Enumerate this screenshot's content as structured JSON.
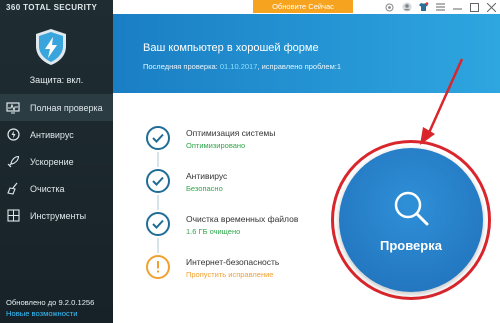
{
  "app": {
    "brand": "360 TOTAL SECURITY"
  },
  "sidebar": {
    "protection_text": "Защита: вкл.",
    "items": [
      {
        "label": "Полная проверка",
        "icon": "monitor-icon"
      },
      {
        "label": "Антивирус",
        "icon": "bolt-icon"
      },
      {
        "label": "Ускорение",
        "icon": "rocket-icon"
      },
      {
        "label": "Очистка",
        "icon": "broom-icon"
      },
      {
        "label": "Инструменты",
        "icon": "grid-icon"
      }
    ],
    "footer": {
      "version": "Обновлено до 9.2.0.1256",
      "link": "Новые возможности"
    }
  },
  "topbar": {
    "update_button": "Обновите Сейчас"
  },
  "banner": {
    "title": "Ваш компьютер в хорошей форме",
    "last_check_prefix": "Последняя проверка:",
    "last_check_date": "01.10.2017",
    "last_check_suffix": ", исправлено проблем:1"
  },
  "status": [
    {
      "title": "Оптимизация системы",
      "state": "Оптимизировано",
      "type": "ok"
    },
    {
      "title": "Антивирус",
      "state": "Безопасно",
      "type": "ok"
    },
    {
      "title": "Очистка временных файлов",
      "state": "1.6 ГБ очищено",
      "type": "ok"
    },
    {
      "title": "Интернет-безопасность",
      "state": "Пропустить исправление",
      "type": "warn"
    }
  ],
  "scan_button": {
    "label": "Проверка"
  },
  "colors": {
    "sidebar_bg": "#1f2d33",
    "banner": "#1a7ec4",
    "ok": "#2fa64a",
    "warn": "#f0a030",
    "update": "#f6a420",
    "halo": "#d9262c"
  }
}
